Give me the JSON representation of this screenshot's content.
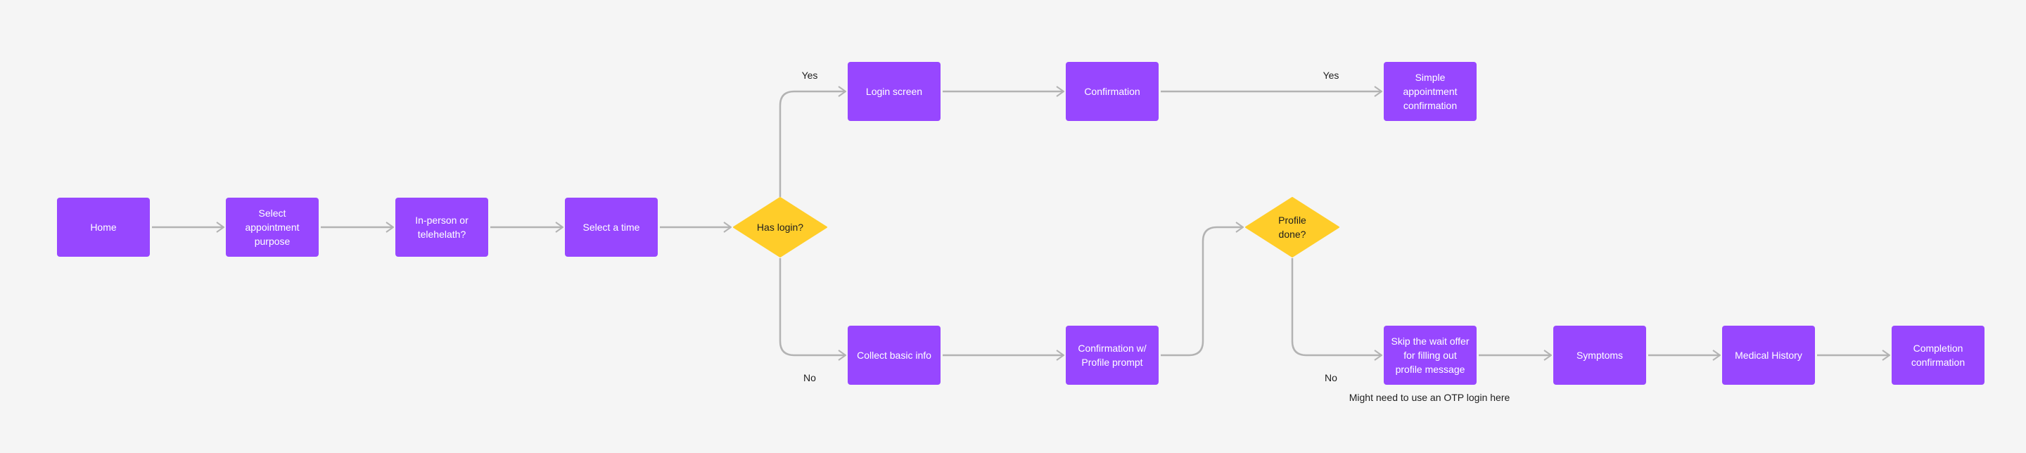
{
  "colors": {
    "background": "#f5f5f5",
    "process": "#9747ff",
    "decision": "#ffcd29",
    "connector": "#b3b3b3"
  },
  "nodes": {
    "home": "Home",
    "purpose": "Select appointment purpose",
    "mode": "In-person or telehelath?",
    "time": "Select a time",
    "has_login": "Has login?",
    "login": "Login screen",
    "confirmation": "Confirmation",
    "simple_conf": "Simple appointment confirmation",
    "collect": "Collect basic info",
    "conf_profile": "Confirmation w/ Profile prompt",
    "profile_done": "Profile done?",
    "skip_wait": "Skip the wait offer for filling out profile message",
    "symptoms": "Symptoms",
    "history": "Medical History",
    "completion": "Completion confirmation"
  },
  "labels": {
    "yes1": "Yes",
    "yes2": "Yes",
    "no1": "No",
    "no2": "No",
    "otp_note": "Might need to use an OTP login here"
  }
}
